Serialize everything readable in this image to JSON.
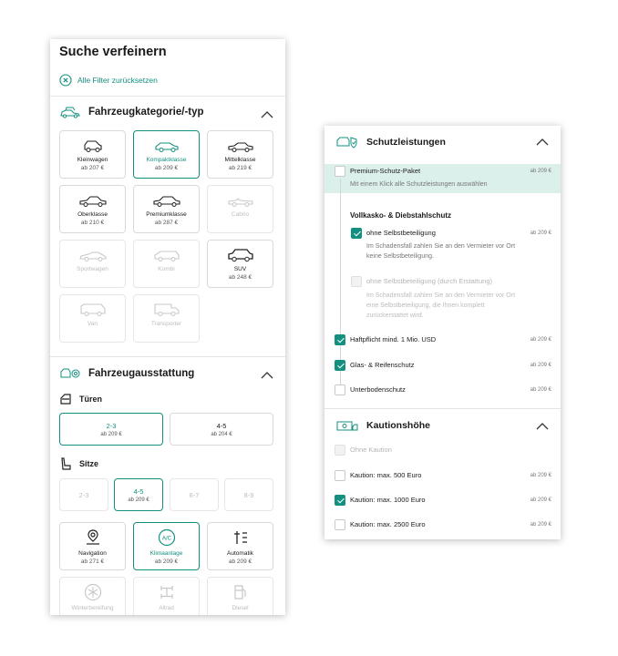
{
  "left": {
    "title": "Suche verfeinern",
    "reset_label": "Alle Filter zurücksetzen",
    "category": {
      "title": "Fahrzeugkategorie/-typ",
      "tiles": [
        {
          "name": "Kleinwagen",
          "price": "ab 207 €"
        },
        {
          "name": "Kompaktklasse",
          "price": "ab 209 €"
        },
        {
          "name": "Mittelklasse",
          "price": "ab 219 €"
        },
        {
          "name": "Oberklasse",
          "price": "ab 210 €"
        },
        {
          "name": "Premiumklasse",
          "price": "ab 287 €"
        },
        {
          "name": "Cabrio",
          "price": ""
        },
        {
          "name": "Sportwagen",
          "price": ""
        },
        {
          "name": "Kombi",
          "price": ""
        },
        {
          "name": "SUV",
          "price": "ab 248 €"
        },
        {
          "name": "Van",
          "price": ""
        },
        {
          "name": "Transporter",
          "price": ""
        }
      ]
    },
    "equipment": {
      "title": "Fahrzeugausstattung",
      "doors_title": "Türen",
      "doors": [
        {
          "value": "2-3",
          "price": "ab 209 €"
        },
        {
          "value": "4-5",
          "price": "ab 204 €"
        }
      ],
      "seats_title": "Sitze",
      "seats": [
        {
          "value": "2-3",
          "price": ""
        },
        {
          "value": "4-5",
          "price": "ab 209 €"
        },
        {
          "value": "6-7",
          "price": ""
        },
        {
          "value": "8-9",
          "price": ""
        }
      ],
      "features": [
        {
          "name": "Navigation",
          "price": "ab 271 €"
        },
        {
          "name": "Klimaanlage",
          "price": "ab 209 €"
        },
        {
          "name": "Automatik",
          "price": "ab 209 €"
        },
        {
          "name": "Winterbereifung",
          "price": ""
        },
        {
          "name": "Allrad",
          "price": ""
        },
        {
          "name": "Diesel",
          "price": ""
        }
      ],
      "ac_icon_text": "A/C"
    }
  },
  "right": {
    "protection": {
      "title": "Schutzleistungen",
      "premium_label": "Premium-Schutz-Paket",
      "premium_price": "ab 209 €",
      "premium_desc": "Mit einem Klick alle Schutzleistungen auswählen",
      "group_title": "Vollkasko- & Diebstahlschutz",
      "no_deductible_label": "ohne Selbstbeteiligung",
      "no_deductible_price": "ab 209 €",
      "no_deductible_desc_1": "Im Schadensfall zahlen Sie an den Vermieter vor Ort",
      "no_deductible_desc_2": "keine Selbstbeteiligung.",
      "refund_label": "ohne Selbstbeteiligung (durch Erstattung)",
      "refund_desc_1": "Im Schadensfall zahlen Sie an den Vermieter vor Ort",
      "refund_desc_2": "eine Selbstbeteiligung, die Ihnen komplett",
      "refund_desc_3": "zurückerstattet wird.",
      "liability_label": "Haftpflicht mind. 1 Mio. USD",
      "liability_price": "ab 209 €",
      "glass_label": "Glas- & Reifenschutz",
      "glass_price": "ab 209 €",
      "underbody_label": "Unterbodenschutz",
      "underbody_price": "ab 209 €"
    },
    "deposit": {
      "title": "Kautionshöhe",
      "options": [
        {
          "label": "Ohne Kaution",
          "price": ""
        },
        {
          "label": "Kaution: max. 500 Euro",
          "price": "ab 209 €"
        },
        {
          "label": "Kaution: max. 1000 Euro",
          "price": "ab 209 €"
        },
        {
          "label": "Kaution: max. 2500 Euro",
          "price": "ab 209 €"
        }
      ]
    }
  },
  "colors": {
    "accent": "#13907f",
    "highlight": "#dbefeb"
  }
}
